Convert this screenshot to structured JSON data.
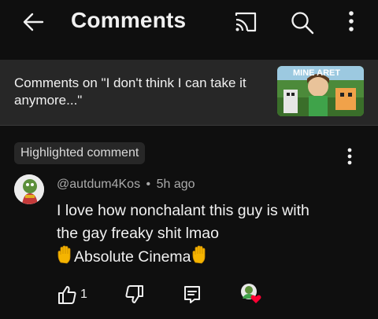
{
  "header": {
    "title": "Comments",
    "icons": [
      "back-arrow-icon",
      "cast-icon",
      "search-icon",
      "more-vertical-icon"
    ]
  },
  "video": {
    "title": "Comments on \"I don't think I can take it anymore...\"",
    "thumbnail_text": "MINE ARET"
  },
  "comment": {
    "badge": "Highlighted comment",
    "author": "@autdum4Kos",
    "separator": "•",
    "time": "5h ago",
    "line1": "I love how nonchalant this guy is with",
    "line2": "the gay freaky shit lmao",
    "line3": "Absolute Cinema",
    "like_count": "1",
    "icons": [
      "thumbs-up-icon",
      "thumbs-down-icon",
      "reply-icon",
      "creator-heart-icon"
    ]
  },
  "colors": {
    "background": "#0f0f0f",
    "panel": "#272727",
    "text": "#f1f1f1",
    "muted": "#aaaaaa",
    "heart": "#ff0033",
    "hand": "#f5b400"
  }
}
